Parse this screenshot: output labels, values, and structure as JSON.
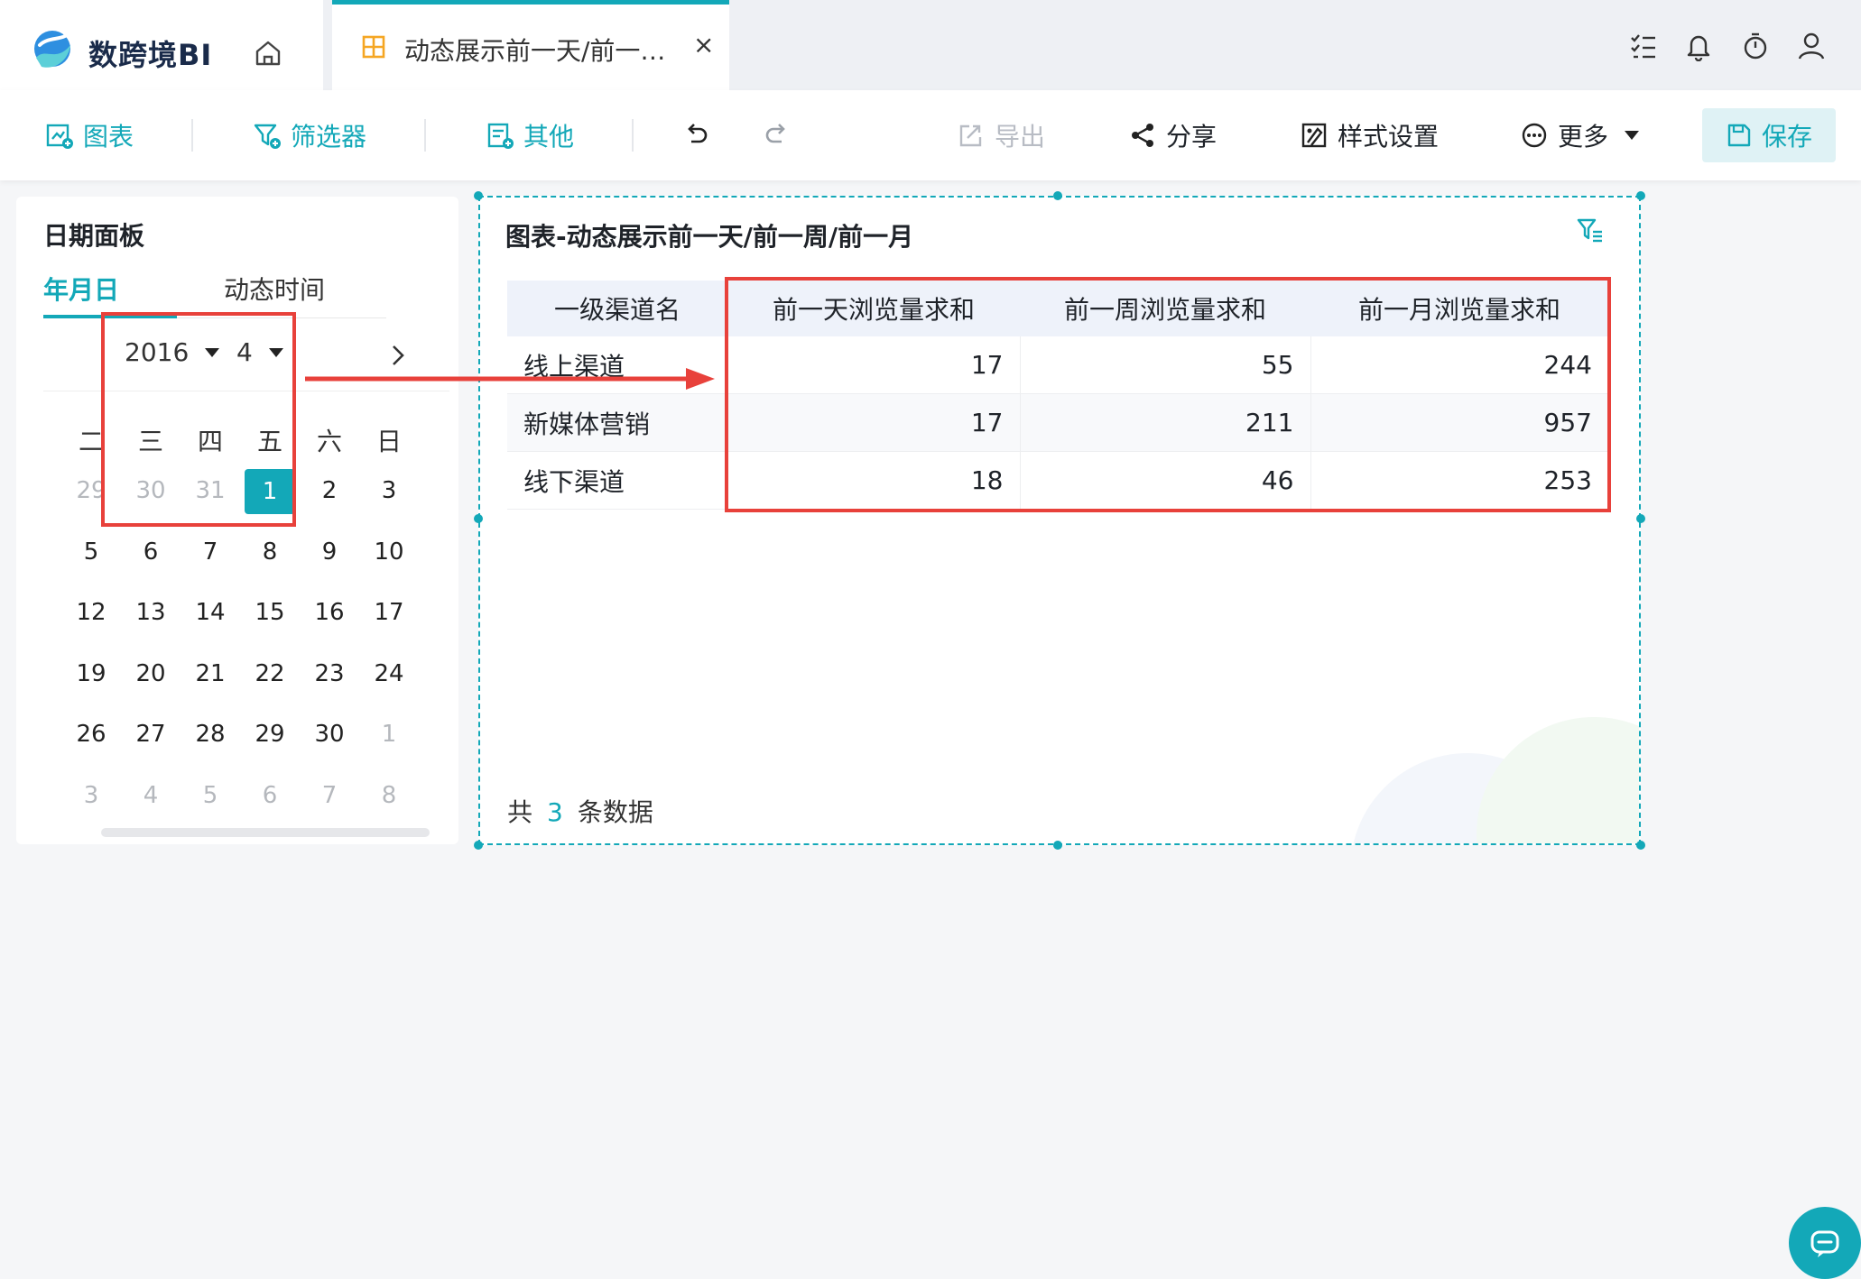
{
  "brand": {
    "logo_text": "数跨境BI"
  },
  "tab": {
    "label": "动态展示前一天/前一…",
    "close": "×"
  },
  "toolbar": {
    "chart": "图表",
    "filter": "筛选器",
    "other": "其他",
    "export": "导出",
    "share": "分享",
    "style": "样式设置",
    "more": "更多",
    "save": "保存"
  },
  "date_panel": {
    "title": "日期面板",
    "tab_ymd": "年月日",
    "tab_dynamic": "动态时间",
    "year": "2016",
    "month": "4",
    "weekdays": [
      "二",
      "三",
      "四",
      "五",
      "六",
      "日"
    ],
    "weeks": [
      [
        {
          "d": "29",
          "m": true
        },
        {
          "d": "30",
          "m": true
        },
        {
          "d": "31",
          "m": true
        },
        {
          "d": "1",
          "s": true
        },
        {
          "d": "2"
        },
        {
          "d": "3"
        }
      ],
      [
        {
          "d": "5"
        },
        {
          "d": "6"
        },
        {
          "d": "7"
        },
        {
          "d": "8"
        },
        {
          "d": "9"
        },
        {
          "d": "10"
        }
      ],
      [
        {
          "d": "12"
        },
        {
          "d": "13"
        },
        {
          "d": "14"
        },
        {
          "d": "15"
        },
        {
          "d": "16"
        },
        {
          "d": "17"
        }
      ],
      [
        {
          "d": "19"
        },
        {
          "d": "20"
        },
        {
          "d": "21"
        },
        {
          "d": "22"
        },
        {
          "d": "23"
        },
        {
          "d": "24"
        }
      ],
      [
        {
          "d": "26"
        },
        {
          "d": "27"
        },
        {
          "d": "28"
        },
        {
          "d": "29"
        },
        {
          "d": "30"
        },
        {
          "d": "1",
          "m": true
        }
      ],
      [
        {
          "d": "3",
          "m": true
        },
        {
          "d": "4",
          "m": true
        },
        {
          "d": "5",
          "m": true
        },
        {
          "d": "6",
          "m": true
        },
        {
          "d": "7",
          "m": true
        },
        {
          "d": "8",
          "m": true
        }
      ]
    ]
  },
  "widget": {
    "title": "图表-动态展示前一天/前一周/前一月",
    "columns": [
      "一级渠道名",
      "前一天浏览量求和",
      "前一周浏览量求和",
      "前一月浏览量求和"
    ],
    "rows": [
      [
        "线上渠道",
        "17",
        "55",
        "244"
      ],
      [
        "新媒体营销",
        "17",
        "211",
        "957"
      ],
      [
        "线下渠道",
        "18",
        "46",
        "253"
      ]
    ],
    "total_prefix": "共",
    "total_count": "3",
    "total_suffix": "条数据"
  },
  "colors": {
    "accent": "#13a8b8",
    "annotation": "#e8413b"
  }
}
